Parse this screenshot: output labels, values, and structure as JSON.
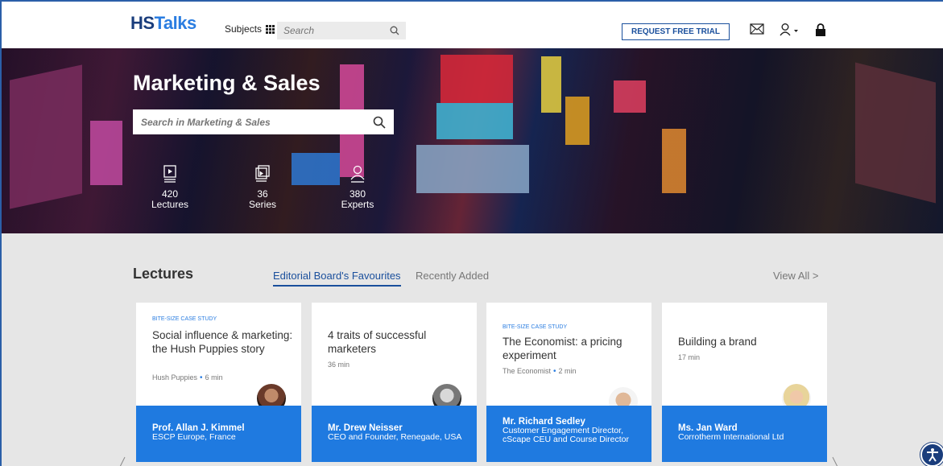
{
  "header": {
    "logo_hs": "HS",
    "logo_talks": "Talks",
    "subjects_label": "Subjects",
    "search_placeholder": "Search",
    "trial_button": "REQUEST FREE TRIAL",
    "icons": [
      "mail-icon",
      "user-icon",
      "lock-icon"
    ]
  },
  "hero": {
    "title": "Marketing & Sales",
    "search_placeholder": "Search in Marketing & Sales",
    "stats": [
      {
        "count": "420",
        "label": "Lectures",
        "icon": "lecture-icon"
      },
      {
        "count": "36",
        "label": "Series",
        "icon": "series-icon"
      },
      {
        "count": "380",
        "label": "Experts",
        "icon": "expert-icon"
      }
    ]
  },
  "lectures": {
    "title": "Lectures",
    "tabs": [
      "Editorial Board's Favourites",
      "Recently Added"
    ],
    "active_tab": "Editorial Board's Favourites",
    "view_all": "View All >",
    "cards": [
      {
        "category": "BITE-SIZE CASE STUDY",
        "title": "Social influence & marketing: the Hush Puppies story",
        "source": "Hush Puppies",
        "duration": "6 min",
        "speaker": "Prof. Allan J. Kimmel",
        "affiliation": "ESCP Europe, France"
      },
      {
        "category": "",
        "title": "4 traits of successful marketers",
        "source": "",
        "duration": "36 min",
        "speaker": "Mr. Drew Neisser",
        "affiliation": "CEO and Founder, Renegade, USA"
      },
      {
        "category": "BITE-SIZE CASE STUDY",
        "title": "The Economist: a pricing experiment",
        "source": "The Economist",
        "duration": "2 min",
        "speaker": "Mr. Richard Sedley",
        "affiliation": "Customer Engagement Director, cScape CEU and Course Director"
      },
      {
        "category": "",
        "title": "Building a brand",
        "source": "",
        "duration": "17 min",
        "speaker": "Ms. Jan Ward",
        "affiliation": "Corrotherm International Ltd"
      }
    ]
  },
  "colors": {
    "brand_dark": "#1a3d7c",
    "brand_accent": "#2a7de1",
    "card_blue": "#1f7ae0",
    "page_bg": "#e6e6e6"
  }
}
